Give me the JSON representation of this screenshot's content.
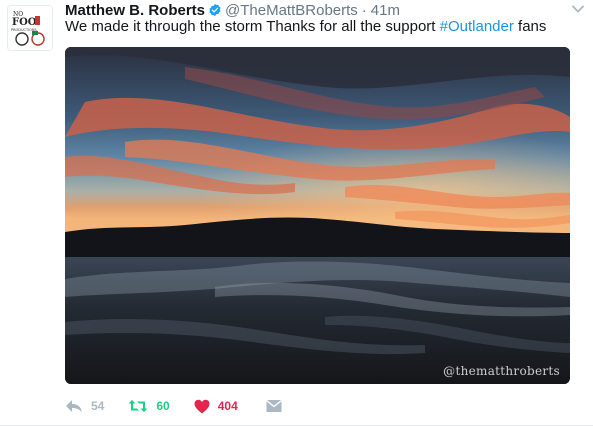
{
  "tweet": {
    "author_name": "Matthew B. Roberts",
    "handle": "@TheMattBRoberts",
    "separator": "·",
    "time": "41m",
    "text_before": "We made it through the storm Thanks for all the support ",
    "hashtag": "#Outlander",
    "text_after": " fans",
    "media_watermark": "@thematthroberts",
    "avatar_text": "NO FOOL PRODUCTIONS",
    "verified_icon": "verified-badge-icon",
    "colors": {
      "link": "#1b95e0",
      "verified": "#1da1f2",
      "retweet": "#19cf86",
      "like": "#e2264d",
      "muted": "#aab8c2"
    }
  },
  "actions": {
    "reply_count": "54",
    "retweet_count": "60",
    "like_count": "404"
  }
}
